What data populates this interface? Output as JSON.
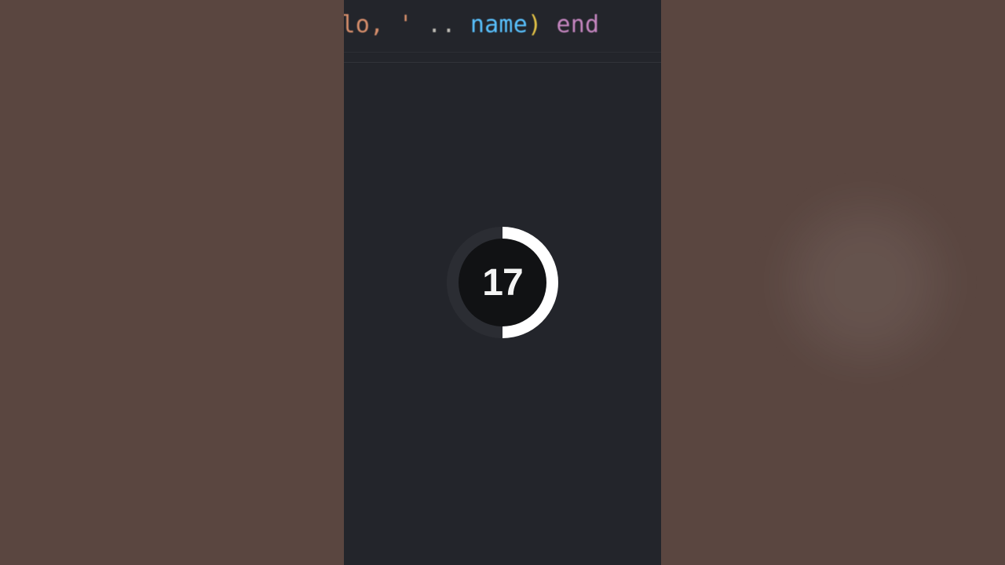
{
  "code": {
    "tokens": [
      {
        "cls": "tok-str",
        "text": "ello, "
      },
      {
        "cls": "tok-str",
        "text": "'"
      },
      {
        "cls": "tok-punc",
        "text": " "
      },
      {
        "cls": "tok-op",
        "text": ".."
      },
      {
        "cls": "tok-punc",
        "text": " "
      },
      {
        "cls": "tok-var",
        "text": "name"
      },
      {
        "cls": "tok-paren",
        "text": ")"
      },
      {
        "cls": "tok-punc",
        "text": " "
      },
      {
        "cls": "tok-kw",
        "text": "end"
      }
    ]
  },
  "timer": {
    "value": "17",
    "progress_deg_start": 0,
    "progress_deg_end": 180
  },
  "colors": {
    "editor_bg": "#23252b",
    "pillar_bg": "#5a4640",
    "ring_fg": "#ffffff",
    "disc_bg": "#111214"
  }
}
